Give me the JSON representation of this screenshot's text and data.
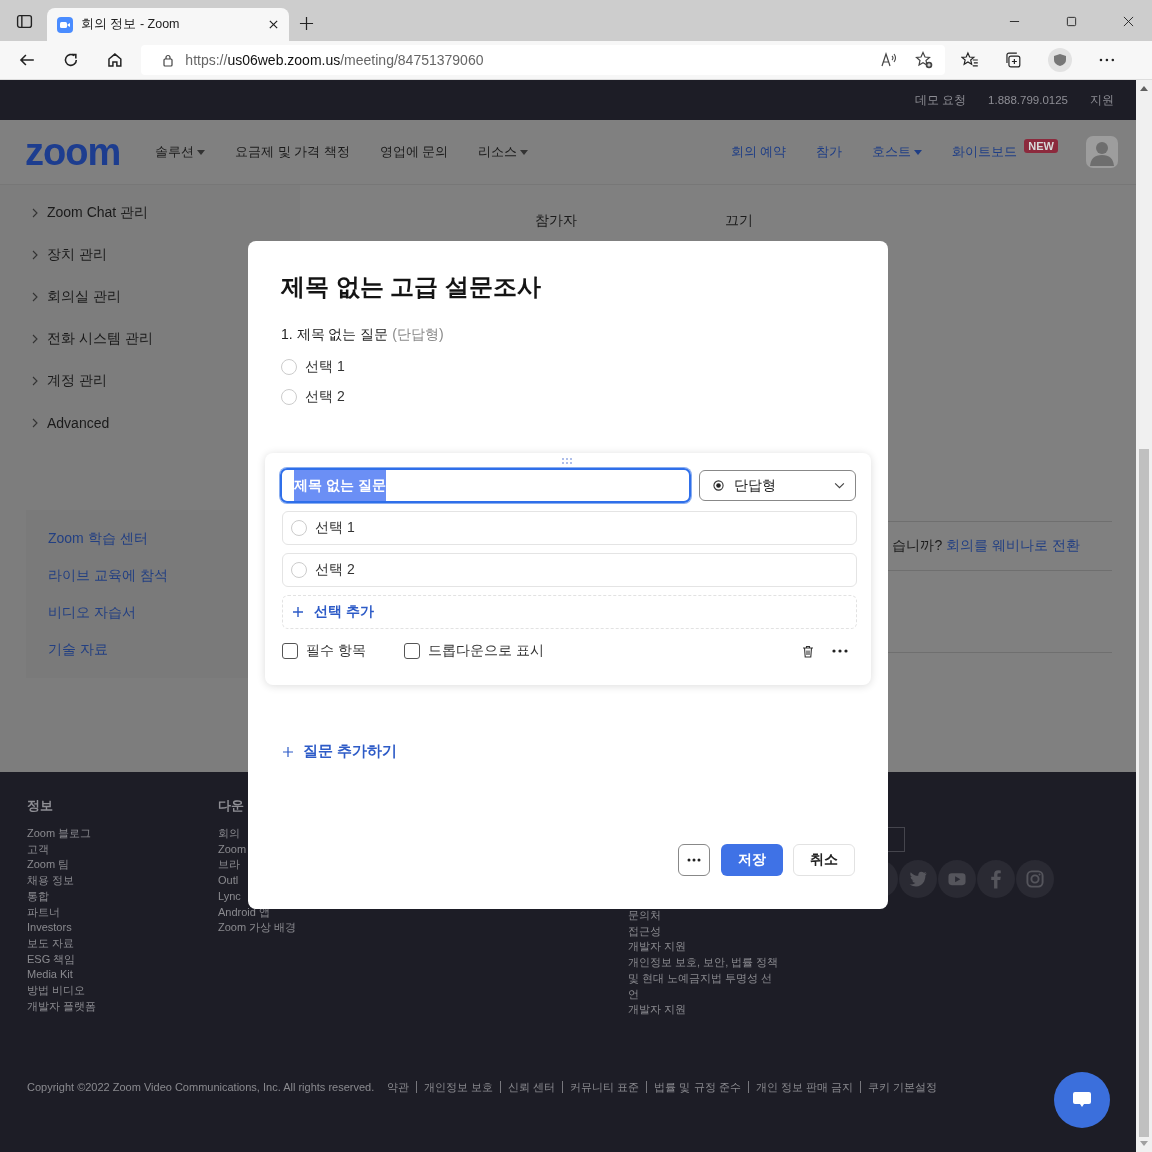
{
  "browser": {
    "tab_title": "회의 정보 - Zoom",
    "url": {
      "scheme": "https://",
      "host": "us06web.zoom.us",
      "path": "/meeting/84751379060"
    }
  },
  "top_bar": [
    "데모 요청",
    "1.888.799.0125",
    "지원"
  ],
  "header": {
    "logo": "zoom",
    "nav_left": [
      {
        "label": "솔루션",
        "dropdown": true
      },
      {
        "label": "요금제 및 가격 책정",
        "dropdown": false
      },
      {
        "label": "영업에 문의",
        "dropdown": false
      },
      {
        "label": "리소스",
        "dropdown": true
      }
    ],
    "nav_right": [
      {
        "label": "회의 예약",
        "dropdown": false
      },
      {
        "label": "참가",
        "dropdown": false
      },
      {
        "label": "호스트",
        "dropdown": true
      },
      {
        "label": "화이트보드",
        "dropdown": false,
        "badge": "NEW"
      }
    ]
  },
  "sidebar": {
    "items": [
      "Zoom Chat 관리",
      "장치 관리",
      "회의실 관리",
      "전화 시스템 관리",
      "계정 관리",
      "Advanced"
    ],
    "learning_links": [
      "Zoom 학습 센터",
      "라이브 교육에 참석",
      "비디오 자습서",
      "기술 자료"
    ]
  },
  "main": {
    "row": [
      "참가자",
      "끄기"
    ],
    "notice": {
      "text": "습니까?",
      "link": "회의를 웨비나로 전환"
    }
  },
  "modal": {
    "title": "제목 없는 고급 설문조사",
    "preview": {
      "question": "1. 제목 없는 질문",
      "type": "(단답형)",
      "choices": [
        {
          "label": "선택 1",
          "selected": false
        },
        {
          "label": "선택 2",
          "selected": false
        }
      ]
    },
    "editor": {
      "question": "제목 없는 질문",
      "type": "단답형",
      "choices": [
        {
          "label": "선택 1",
          "selected": false
        },
        {
          "label": "선택 2",
          "selected": false
        }
      ],
      "add_choice": "선택 추가",
      "options": [
        {
          "label": "필수 항목",
          "checked": false
        },
        {
          "label": "드롭다운으로 표시",
          "checked": false
        }
      ]
    },
    "add_question": "질문 추가하기",
    "buttons": {
      "save": "저장",
      "cancel": "취소"
    }
  },
  "footer": {
    "columns": [
      {
        "heading": "정보",
        "items": [
          "Zoom 블로그",
          "고객",
          "Zoom 팀",
          "채용 정보",
          "통합",
          "파트너",
          "Investors",
          "보도 자료",
          "ESG 책임",
          "Media Kit",
          "방법 비디오",
          "개발자 플랫폼"
        ]
      },
      {
        "heading": "다운",
        "items": [
          "회의",
          "Zoom",
          "브라",
          "Outl",
          "Lync",
          "Android 앱",
          "Zoom 가상 배경"
        ]
      },
      {
        "items": [
          "문의처",
          "접근성",
          "개발자 지원",
          "개인정보 보호, 보안, 법률 정책 및 현대 노예금지법 투명성 선언",
          "개발자 지원"
        ]
      }
    ],
    "copyright": "Copyright ©2022 Zoom Video Communications, Inc. All rights reserved.",
    "links": [
      "약관",
      "개인정보 보호",
      "신뢰 센터",
      "커뮤니티 표준",
      "법률 및 규정 준수",
      "개인 정보 판매 금지",
      "쿠키 기본설정"
    ]
  }
}
